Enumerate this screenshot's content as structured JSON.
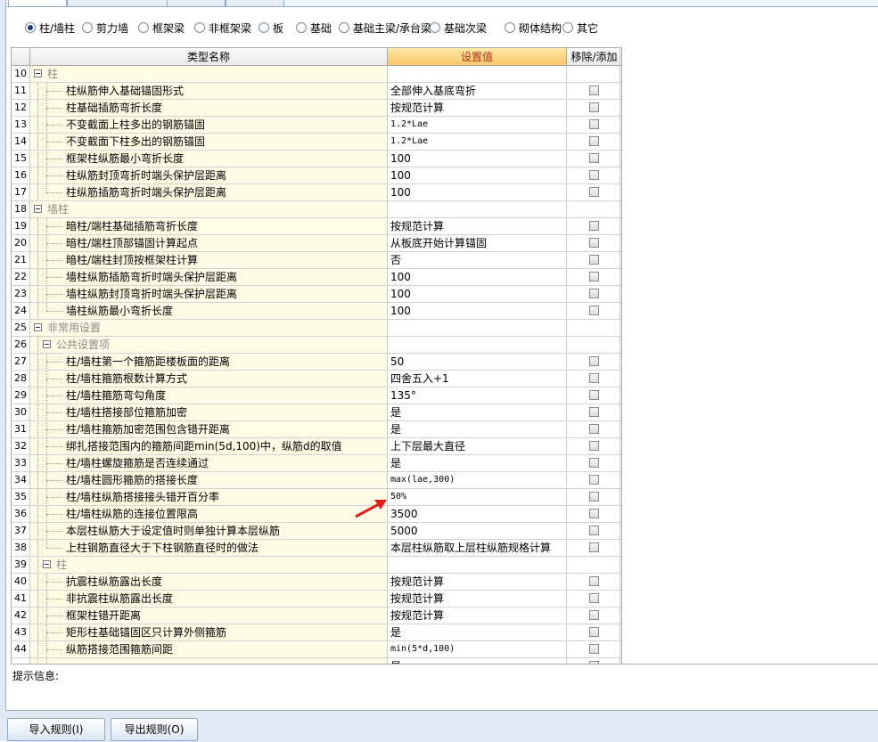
{
  "tabs": [
    "",
    "",
    "",
    ""
  ],
  "element_types": {
    "selected": 0,
    "options": [
      "柱/墙柱",
      "剪力墙",
      "框架梁",
      "非框架梁",
      "板",
      "基础",
      "基础主梁/承台梁",
      "基础次梁",
      "砌体结构",
      "其它"
    ]
  },
  "grid": {
    "headers": {
      "name": "类型名称",
      "value": "设置值",
      "action": "移除/添加"
    },
    "rows": [
      {
        "num": "10",
        "level": 0,
        "kind": "group",
        "label": "柱",
        "value": "",
        "checkbox": false
      },
      {
        "num": "11",
        "level": 1,
        "kind": "item",
        "label": "柱纵筋伸入基础锚固形式",
        "value": "全部伸入基底弯折",
        "checkbox": true
      },
      {
        "num": "12",
        "level": 1,
        "kind": "item",
        "label": "柱基础插筋弯折长度",
        "value": "按规范计算",
        "checkbox": true
      },
      {
        "num": "13",
        "level": 1,
        "kind": "item",
        "label": "不变截面上柱多出的钢筋锚固",
        "value": "1.2*Lae",
        "mono": true,
        "checkbox": true
      },
      {
        "num": "14",
        "level": 1,
        "kind": "item",
        "label": "不变截面下柱多出的钢筋锚固",
        "value": "1.2*Lae",
        "mono": true,
        "checkbox": true
      },
      {
        "num": "15",
        "level": 1,
        "kind": "item",
        "label": "框架柱纵筋最小弯折长度",
        "value": "100",
        "checkbox": true
      },
      {
        "num": "16",
        "level": 1,
        "kind": "item",
        "label": "柱纵筋封顶弯折时端头保护层距离",
        "value": "100",
        "checkbox": true
      },
      {
        "num": "17",
        "level": 1,
        "kind": "item",
        "label": "柱纵筋插筋弯折时端头保护层距离",
        "value": "100",
        "checkbox": true,
        "last": true
      },
      {
        "num": "18",
        "level": 0,
        "kind": "group",
        "label": "墙柱",
        "value": "",
        "checkbox": false
      },
      {
        "num": "19",
        "level": 1,
        "kind": "item",
        "label": "暗柱/端柱基础插筋弯折长度",
        "value": "按规范计算",
        "checkbox": true
      },
      {
        "num": "20",
        "level": 1,
        "kind": "item",
        "label": "暗柱/端柱顶部锚固计算起点",
        "value": "从板底开始计算锚固",
        "checkbox": true
      },
      {
        "num": "21",
        "level": 1,
        "kind": "item",
        "label": "暗柱/端柱封顶按框架柱计算",
        "value": "否",
        "checkbox": true
      },
      {
        "num": "22",
        "level": 1,
        "kind": "item",
        "label": "墙柱纵筋插筋弯折时端头保护层距离",
        "value": "100",
        "checkbox": true
      },
      {
        "num": "23",
        "level": 1,
        "kind": "item",
        "label": "墙柱纵筋封顶弯折时端头保护层距离",
        "value": "100",
        "checkbox": true
      },
      {
        "num": "24",
        "level": 1,
        "kind": "item",
        "label": "墙柱纵筋最小弯折长度",
        "value": "100",
        "checkbox": true,
        "last": true
      },
      {
        "num": "25",
        "level": -1,
        "kind": "group",
        "label": "非常用设置",
        "value": "",
        "checkbox": false
      },
      {
        "num": "26",
        "level": 0,
        "kind": "group",
        "label": "公共设置项",
        "value": "",
        "checkbox": false,
        "indented": true
      },
      {
        "num": "27",
        "level": 1,
        "kind": "item",
        "label": "柱/墙柱第一个箍筋距楼板面的距离",
        "value": "50",
        "checkbox": true
      },
      {
        "num": "28",
        "level": 1,
        "kind": "item",
        "label": "柱/墙柱箍筋根数计算方式",
        "value": "四舍五入+1",
        "checkbox": true
      },
      {
        "num": "29",
        "level": 1,
        "kind": "item",
        "label": "柱/墙柱箍筋弯勾角度",
        "value": "135°",
        "checkbox": true
      },
      {
        "num": "30",
        "level": 1,
        "kind": "item",
        "label": "柱/墙柱搭接部位箍筋加密",
        "value": "是",
        "checkbox": true
      },
      {
        "num": "31",
        "level": 1,
        "kind": "item",
        "label": "柱/墙柱箍筋加密范围包含错开距离",
        "value": "是",
        "checkbox": true
      },
      {
        "num": "32",
        "level": 1,
        "kind": "item",
        "label": "绑扎搭接范围内的箍筋间距min(5d,100)中，纵筋d的取值",
        "value": "上下层最大直径",
        "checkbox": true
      },
      {
        "num": "33",
        "level": 1,
        "kind": "item",
        "label": "柱/墙柱螺旋箍筋是否连续通过",
        "value": "是",
        "checkbox": true
      },
      {
        "num": "34",
        "level": 1,
        "kind": "item",
        "label": "柱/墙柱圆形箍筋的搭接长度",
        "value": "max(lae,300)",
        "mono": true,
        "checkbox": true
      },
      {
        "num": "35",
        "level": 1,
        "kind": "item",
        "label": "柱/墙柱纵筋搭接接头错开百分率",
        "value": "50%",
        "mono": true,
        "checkbox": true
      },
      {
        "num": "36",
        "level": 1,
        "kind": "item",
        "label": "柱/墙柱纵筋的连接位置限高",
        "value": "3500",
        "checkbox": true
      },
      {
        "num": "37",
        "level": 1,
        "kind": "item",
        "label": "本层柱纵筋大于设定值时则单独计算本层纵筋",
        "value": "5000",
        "checkbox": true
      },
      {
        "num": "38",
        "level": 1,
        "kind": "item",
        "label": "上柱钢筋直径大于下柱钢筋直径时的做法",
        "value": "本层柱纵筋取上层柱纵筋规格计算",
        "checkbox": true,
        "last": true
      },
      {
        "num": "39",
        "level": 0,
        "kind": "group",
        "label": "柱",
        "value": "",
        "checkbox": false,
        "indented": true
      },
      {
        "num": "40",
        "level": 1,
        "kind": "item",
        "label": "抗震柱纵筋露出长度",
        "value": "按规范计算",
        "checkbox": true
      },
      {
        "num": "41",
        "level": 1,
        "kind": "item",
        "label": "非抗震柱纵筋露出长度",
        "value": "按规范计算",
        "checkbox": true
      },
      {
        "num": "42",
        "level": 1,
        "kind": "item",
        "label": "框架柱错开距离",
        "value": "按规范计算",
        "checkbox": true
      },
      {
        "num": "43",
        "level": 1,
        "kind": "item",
        "label": "矩形柱基础锚固区只计算外侧箍筋",
        "value": "是",
        "checkbox": true
      },
      {
        "num": "44",
        "level": 1,
        "kind": "item",
        "label": "纵筋搭接范围箍筋间距",
        "value": "min(5*d,100)",
        "mono": true,
        "checkbox": true
      },
      {
        "num": "",
        "level": 1,
        "kind": "item",
        "label": "",
        "value": "是",
        "checkbox": true
      }
    ]
  },
  "info": {
    "label": "提示信息:"
  },
  "buttons": {
    "import": "导入规则(I)",
    "export": "导出规则(O)"
  },
  "colors": {
    "value_header_bg": "#f8c86a",
    "value_header_text": "#b2301e",
    "tree_bg": "#fffce6",
    "arrow": "#e0201c"
  }
}
